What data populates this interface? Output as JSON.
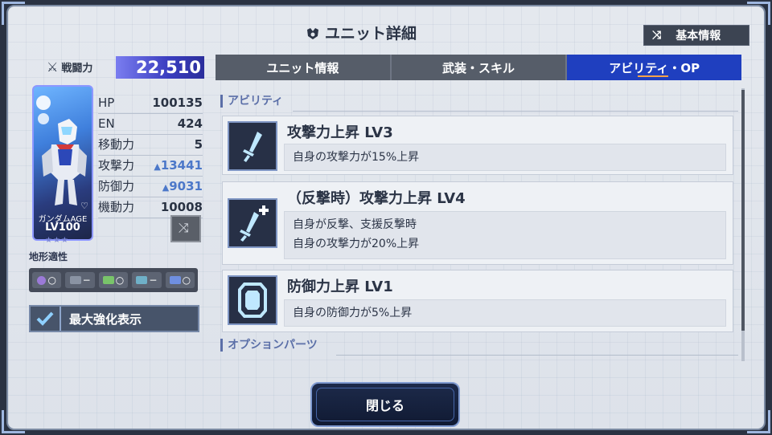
{
  "header": {
    "title": "ユニット詳細",
    "basic_info_label": "基本情報"
  },
  "left": {
    "power_label": "戦闘力",
    "power_value": "22,510",
    "unit": {
      "name": "ガンダムAGE",
      "level": "LV100",
      "stars": "★★★"
    },
    "stats": [
      {
        "label": "HP",
        "value": "100135",
        "boosted": false
      },
      {
        "label": "EN",
        "value": "424",
        "boosted": false
      },
      {
        "label": "移動力",
        "value": "5",
        "boosted": false
      },
      {
        "label": "攻撃力",
        "value": "13441",
        "boosted": true
      },
      {
        "label": "防御力",
        "value": "9031",
        "boosted": true
      },
      {
        "label": "機動力",
        "value": "10008",
        "boosted": false
      }
    ],
    "terrain_label": "地形適性",
    "terrain": [
      {
        "icon": "space-icon",
        "rank": "○",
        "color": "#9b7ad8"
      },
      {
        "icon": "air-icon",
        "rank": "−",
        "color": "#8a93a3"
      },
      {
        "icon": "ground-icon",
        "rank": "○",
        "color": "#79c46a"
      },
      {
        "icon": "water-icon",
        "rank": "−",
        "color": "#6fb0c8"
      },
      {
        "icon": "city-icon",
        "rank": "○",
        "color": "#6f8fe0"
      }
    ],
    "max_enhance_label": "最大強化表示"
  },
  "tabs": [
    {
      "label": "ユニット情報",
      "active": false
    },
    {
      "label": "武装・スキル",
      "active": false
    },
    {
      "label": "アビリティ・OP",
      "active": true
    }
  ],
  "content": {
    "ability_section": "アビリティ",
    "abilities": [
      {
        "name": "攻撃力上昇 LV3",
        "desc": [
          "自身の攻撃力が15%上昇"
        ],
        "icon": "sword-icon"
      },
      {
        "name": "（反撃時）攻撃力上昇 LV4",
        "desc": [
          "自身が反撃、支援反撃時",
          "自身の攻撃力が20%上昇"
        ],
        "icon": "sword-plus-icon"
      },
      {
        "name": "防御力上昇 LV1",
        "desc": [
          "自身の防御力が5%上昇"
        ],
        "icon": "shield-icon"
      }
    ],
    "option_section": "オプションパーツ"
  },
  "close_label": "閉じる"
}
